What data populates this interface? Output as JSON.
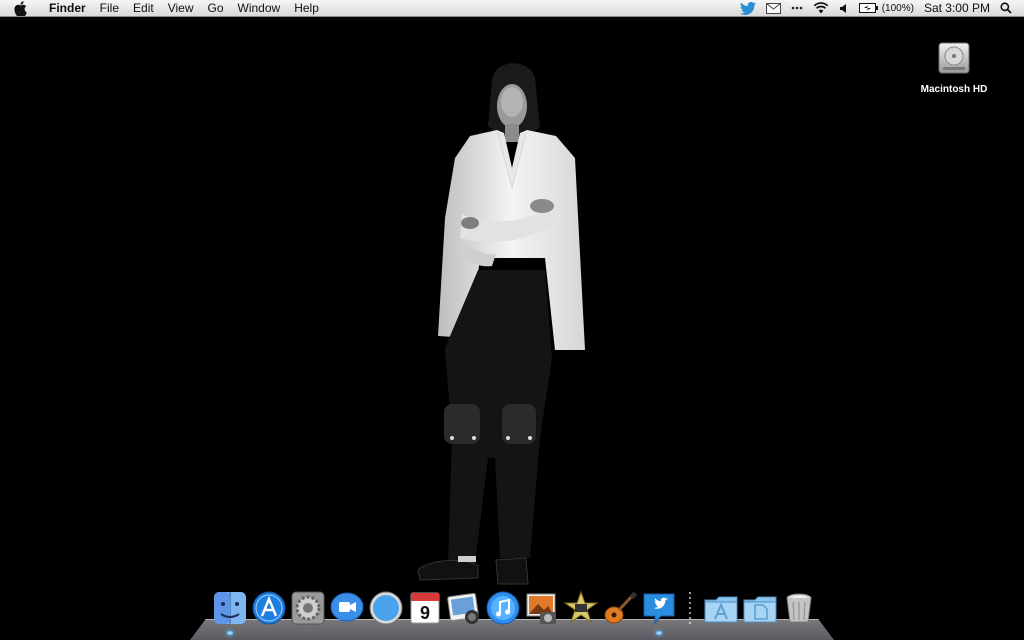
{
  "menubar": {
    "finder": "Finder",
    "items": [
      "File",
      "Edit",
      "View",
      "Go",
      "Window",
      "Help"
    ],
    "battery_text": "(100%)",
    "clock": "Sat 3:00 PM"
  },
  "desktop": {
    "hd_label": "Macintosh HD"
  },
  "dock": {
    "apps": [
      {
        "name": "finder-icon",
        "running": true
      },
      {
        "name": "app-store-icon",
        "running": false
      },
      {
        "name": "system-preferences-icon",
        "running": false
      },
      {
        "name": "facetime-icon",
        "running": false
      },
      {
        "name": "safari-icon",
        "running": false
      },
      {
        "name": "ical-icon",
        "running": false,
        "text": "9"
      },
      {
        "name": "iphoto-address-icon",
        "running": false
      },
      {
        "name": "itunes-icon",
        "running": false
      },
      {
        "name": "photo-booth-icon",
        "running": false
      },
      {
        "name": "imovie-icon",
        "running": false
      },
      {
        "name": "garageband-icon",
        "running": false
      },
      {
        "name": "twitter-icon",
        "running": true
      }
    ],
    "stacks": [
      "applications-folder-icon",
      "documents-folder-icon",
      "trash-icon"
    ]
  },
  "colors": {
    "desktop_bg": "#000000",
    "menubar_bg": "#e6e6e6",
    "dock_indicator": "#3aa0ff"
  }
}
